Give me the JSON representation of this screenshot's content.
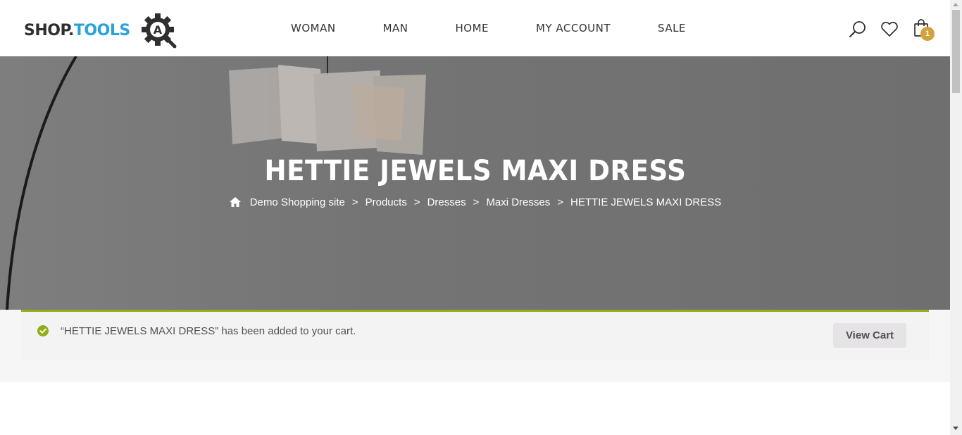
{
  "header": {
    "logo": {
      "shop": "SHOP.",
      "tools": "TOOLS",
      "mark": "A"
    },
    "nav": [
      "WOMAN",
      "MAN",
      "HOME",
      "MY ACCOUNT",
      "SALE"
    ],
    "cart_count": "1"
  },
  "hero": {
    "title": "HETTIE JEWELS MAXI DRESS",
    "breadcrumb": [
      "Demo Shopping site",
      "Products",
      "Dresses",
      "Maxi Dresses",
      "HETTIE JEWELS MAXI DRESS"
    ],
    "separator": ">"
  },
  "notice": {
    "message": "“HETTIE JEWELS MAXI DRESS” has been added to your cart.",
    "button": "View Cart"
  },
  "colors": {
    "accent": "#8fae1b",
    "badge": "#d4a23a",
    "logo_blue": "#2aa3dc"
  }
}
